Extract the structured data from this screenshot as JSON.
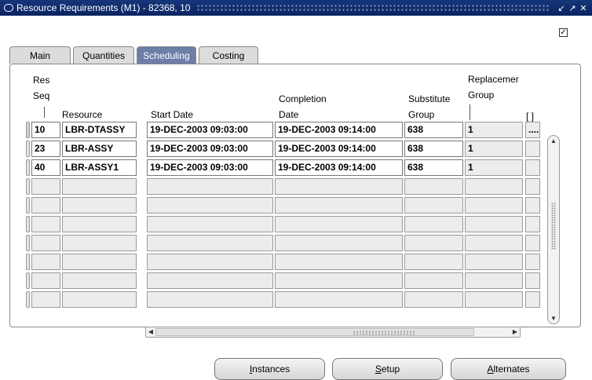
{
  "window": {
    "title": "Resource Requirements (M1) - 82368, 10",
    "controls": [
      "↙",
      "↗",
      "✕"
    ]
  },
  "top_checkbox": {
    "checked": true,
    "glyph": "✓"
  },
  "tabs": [
    {
      "label": "Main",
      "active": false
    },
    {
      "label": "Quantities",
      "active": false
    },
    {
      "label": "Scheduling",
      "active": true
    },
    {
      "label": "Costing",
      "active": false
    }
  ],
  "columns": {
    "res_seq": [
      "Res",
      "Seq"
    ],
    "resource": "Resource",
    "start_date": "Start Date",
    "completion_date": [
      "Completion",
      "Date"
    ],
    "substitute_group": [
      "Substitute",
      "Group"
    ],
    "replacement_group": [
      "Replacemer",
      "Group"
    ],
    "flex": "[ ]"
  },
  "rows": [
    {
      "seq": "10",
      "resource": "LBR-DTASSY",
      "start": "19-DEC-2003 09:03:00",
      "completion": "19-DEC-2003 09:14:00",
      "substitute": "638",
      "replacement": "1",
      "flex": "...."
    },
    {
      "seq": "23",
      "resource": "LBR-ASSY",
      "start": "19-DEC-2003 09:03:00",
      "completion": "19-DEC-2003 09:14:00",
      "substitute": "638",
      "replacement": "1",
      "flex": ""
    },
    {
      "seq": "40",
      "resource": "LBR-ASSY1",
      "start": "19-DEC-2003 09:03:00",
      "completion": "19-DEC-2003 09:14:00",
      "substitute": "638",
      "replacement": "1",
      "flex": ""
    },
    {
      "seq": "",
      "resource": "",
      "start": "",
      "completion": "",
      "substitute": "",
      "replacement": "",
      "flex": ""
    },
    {
      "seq": "",
      "resource": "",
      "start": "",
      "completion": "",
      "substitute": "",
      "replacement": "",
      "flex": ""
    },
    {
      "seq": "",
      "resource": "",
      "start": "",
      "completion": "",
      "substitute": "",
      "replacement": "",
      "flex": ""
    },
    {
      "seq": "",
      "resource": "",
      "start": "",
      "completion": "",
      "substitute": "",
      "replacement": "",
      "flex": ""
    },
    {
      "seq": "",
      "resource": "",
      "start": "",
      "completion": "",
      "substitute": "",
      "replacement": "",
      "flex": ""
    },
    {
      "seq": "",
      "resource": "",
      "start": "",
      "completion": "",
      "substitute": "",
      "replacement": "",
      "flex": ""
    },
    {
      "seq": "",
      "resource": "",
      "start": "",
      "completion": "",
      "substitute": "",
      "replacement": "",
      "flex": ""
    }
  ],
  "scroll": {
    "up": "▲",
    "down": "▼",
    "left": "◀",
    "right": "▶"
  },
  "buttons": {
    "instances": {
      "pre": "",
      "accel": "I",
      "post": "nstances"
    },
    "setup": {
      "pre": "",
      "accel": "S",
      "post": "etup"
    },
    "alternates": {
      "pre": "",
      "accel": "A",
      "post": "lternates"
    }
  }
}
